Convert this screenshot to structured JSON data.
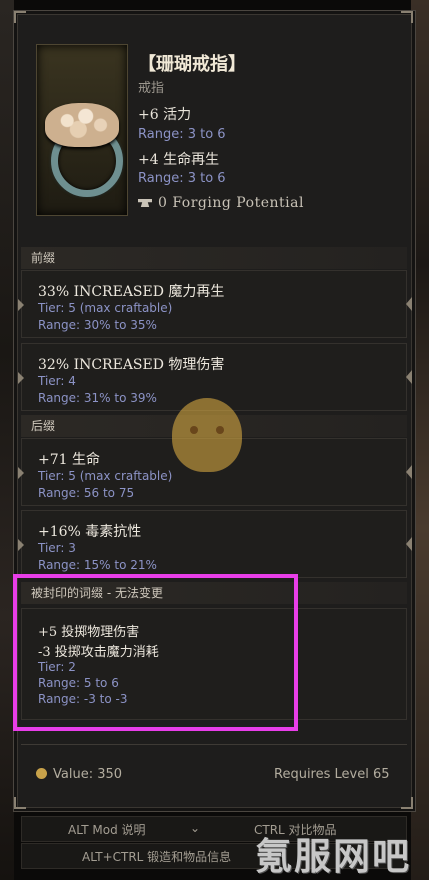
{
  "item": {
    "name": "【珊瑚戒指】",
    "type": "戒指",
    "implicits": [
      {
        "stat": "+6 活力",
        "range": "Range: 3 to 6"
      },
      {
        "stat": "+4 生命再生",
        "range": "Range: 3 to 6"
      }
    ],
    "forging_potential": "0 Forging Potential"
  },
  "prefix": {
    "header": "前缀",
    "affixes": [
      {
        "text": "33% INCREASED 魔力再生",
        "tier": "Tier: 5 (max craftable)",
        "range": "Range: 30% to 35%"
      },
      {
        "text": "32% INCREASED 物理伤害",
        "tier": "Tier: 4",
        "range": "Range: 31% to 39%"
      }
    ]
  },
  "suffix": {
    "header": "后缀",
    "affixes": [
      {
        "text": "+71 生命",
        "tier": "Tier: 5 (max craftable)",
        "range": "Range: 56 to 75"
      },
      {
        "text": "+16% 毒素抗性",
        "tier": "Tier: 3",
        "range": "Range: 15% to 21%"
      }
    ]
  },
  "sealed": {
    "header": "被封印的词缀 - 无法变更",
    "line1": "+5 投掷物理伤害",
    "line2": "-3 投掷攻击魔力消耗",
    "tier": "Tier: 2",
    "range1": "Range: 5 to 6",
    "range2": "Range: -3 to -3"
  },
  "footer": {
    "value": "Value: 350",
    "requires": "Requires Level 65"
  },
  "hints": {
    "row1_left": "ALT Mod 说明",
    "row1_right": "CTRL 对比物品",
    "row2": "ALT+CTRL 锻造和物品信息"
  },
  "watermark": "氪服网吧",
  "colors": {
    "range_text": "#8c93c6",
    "highlight_box": "#e83ee8",
    "panel_bg": "#1e1d1c"
  }
}
